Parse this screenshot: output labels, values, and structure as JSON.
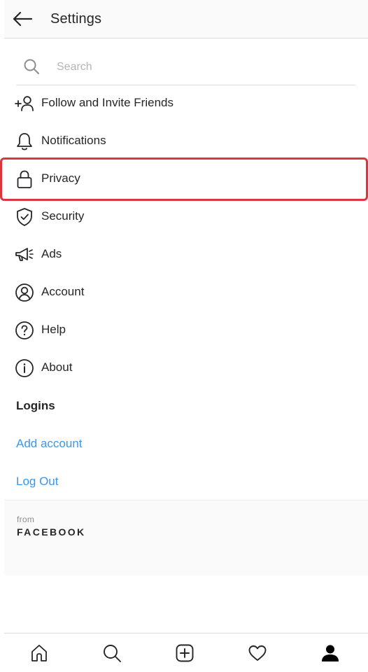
{
  "header": {
    "title": "Settings",
    "back_icon": "arrow-left-icon"
  },
  "search": {
    "placeholder": "Search",
    "value": ""
  },
  "menu": {
    "items": [
      {
        "label": "Follow and Invite Friends",
        "icon": "add-person-icon"
      },
      {
        "label": "Notifications",
        "icon": "bell-icon"
      },
      {
        "label": "Privacy",
        "icon": "lock-icon"
      },
      {
        "label": "Security",
        "icon": "shield-check-icon"
      },
      {
        "label": "Ads",
        "icon": "megaphone-icon"
      },
      {
        "label": "Account",
        "icon": "user-circle-icon"
      },
      {
        "label": "Help",
        "icon": "question-circle-icon"
      },
      {
        "label": "About",
        "icon": "info-circle-icon"
      }
    ]
  },
  "logins": {
    "title": "Logins",
    "add_account": "Add account",
    "log_out": "Log Out"
  },
  "footer": {
    "from": "from",
    "brand": "FACEBOOK"
  },
  "bottom_nav": {
    "items": [
      "home-icon",
      "search-icon",
      "new-post-icon",
      "heart-icon",
      "profile-icon"
    ]
  },
  "colors": {
    "link": "#3897f0",
    "highlight": "#d9363e",
    "text": "#262626"
  }
}
